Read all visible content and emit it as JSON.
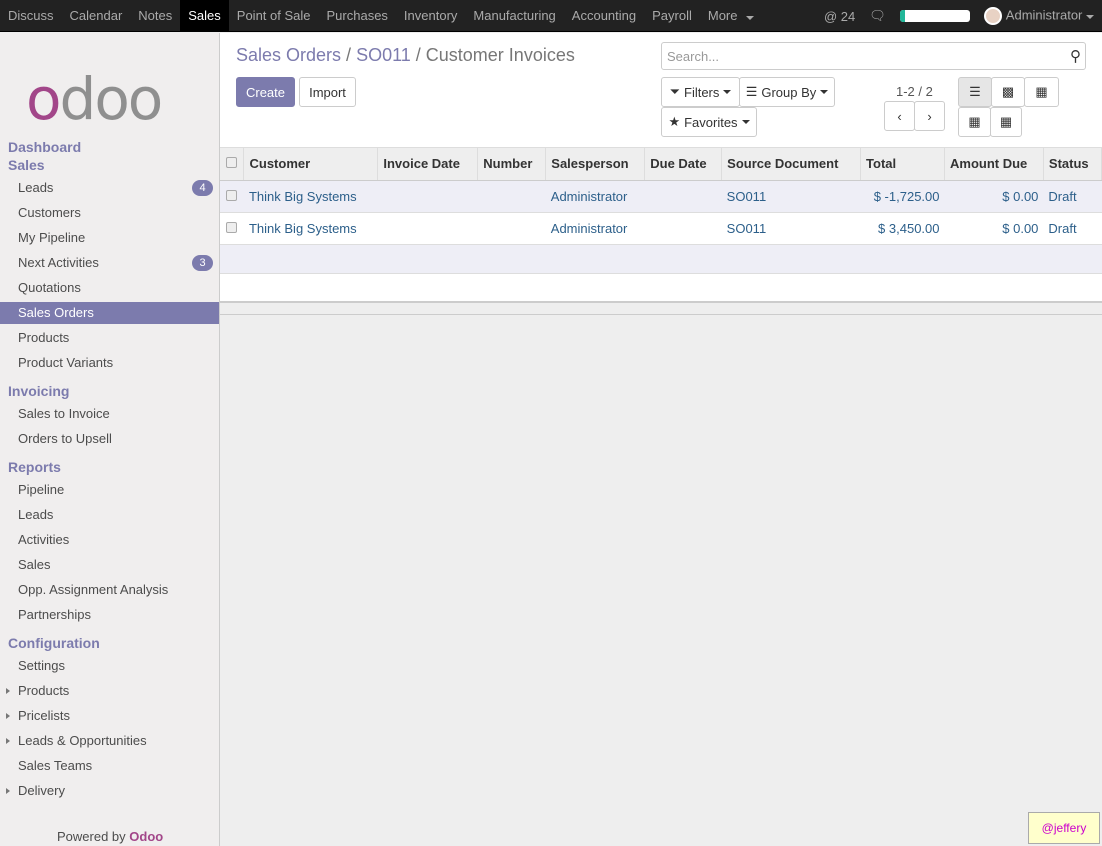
{
  "topbar": {
    "menu": [
      "Discuss",
      "Calendar",
      "Notes",
      "Sales",
      "Point of Sale",
      "Purchases",
      "Inventory",
      "Manufacturing",
      "Accounting",
      "Payroll",
      "More"
    ],
    "active": "Sales",
    "mentions": "@ 24",
    "progress": 0.07,
    "user": "Administrator"
  },
  "sidebar": {
    "logo": "odoo",
    "sections": [
      {
        "title": "Dashboard"
      },
      {
        "title": "Sales",
        "items": [
          {
            "label": "Leads",
            "badge": "4"
          },
          {
            "label": "Customers"
          },
          {
            "label": "My Pipeline"
          },
          {
            "label": "Next Activities",
            "badge": "3"
          },
          {
            "label": "Quotations"
          },
          {
            "label": "Sales Orders",
            "active": true
          },
          {
            "label": "Products"
          },
          {
            "label": "Product Variants"
          }
        ]
      },
      {
        "title": "Invoicing",
        "items": [
          {
            "label": "Sales to Invoice"
          },
          {
            "label": "Orders to Upsell"
          }
        ]
      },
      {
        "title": "Reports",
        "items": [
          {
            "label": "Pipeline"
          },
          {
            "label": "Leads"
          },
          {
            "label": "Activities"
          },
          {
            "label": "Sales"
          },
          {
            "label": "Opp. Assignment Analysis"
          },
          {
            "label": "Partnerships"
          }
        ]
      },
      {
        "title": "Configuration",
        "items": [
          {
            "label": "Settings"
          },
          {
            "label": "Products",
            "caret": true
          },
          {
            "label": "Pricelists",
            "caret": true
          },
          {
            "label": "Leads & Opportunities",
            "caret": true
          },
          {
            "label": "Sales Teams"
          },
          {
            "label": "Delivery",
            "caret": true
          }
        ]
      }
    ],
    "powered": "Powered by",
    "powered_brand": "Odoo"
  },
  "breadcrumb": [
    "Sales Orders",
    "SO011",
    "Customer Invoices"
  ],
  "buttons": {
    "create": "Create",
    "import": "Import",
    "filters": "Filters",
    "group_by": "Group By",
    "favorites": "Favorites"
  },
  "search": {
    "placeholder": "Search..."
  },
  "pager": "1-2 / 2",
  "table": {
    "headers": [
      "Customer",
      "Invoice Date",
      "Number",
      "Salesperson",
      "Due Date",
      "Source Document",
      "Total",
      "Amount Due",
      "Status"
    ],
    "rows": [
      [
        "Think Big Systems",
        "",
        "",
        "Administrator",
        "",
        "SO011",
        "$ -1,725.00",
        "$ 0.00",
        "Draft"
      ],
      [
        "Think Big Systems",
        "",
        "",
        "Administrator",
        "",
        "SO011",
        "$ 3,450.00",
        "$ 0.00",
        "Draft"
      ]
    ]
  },
  "watermark": "@jeffery"
}
